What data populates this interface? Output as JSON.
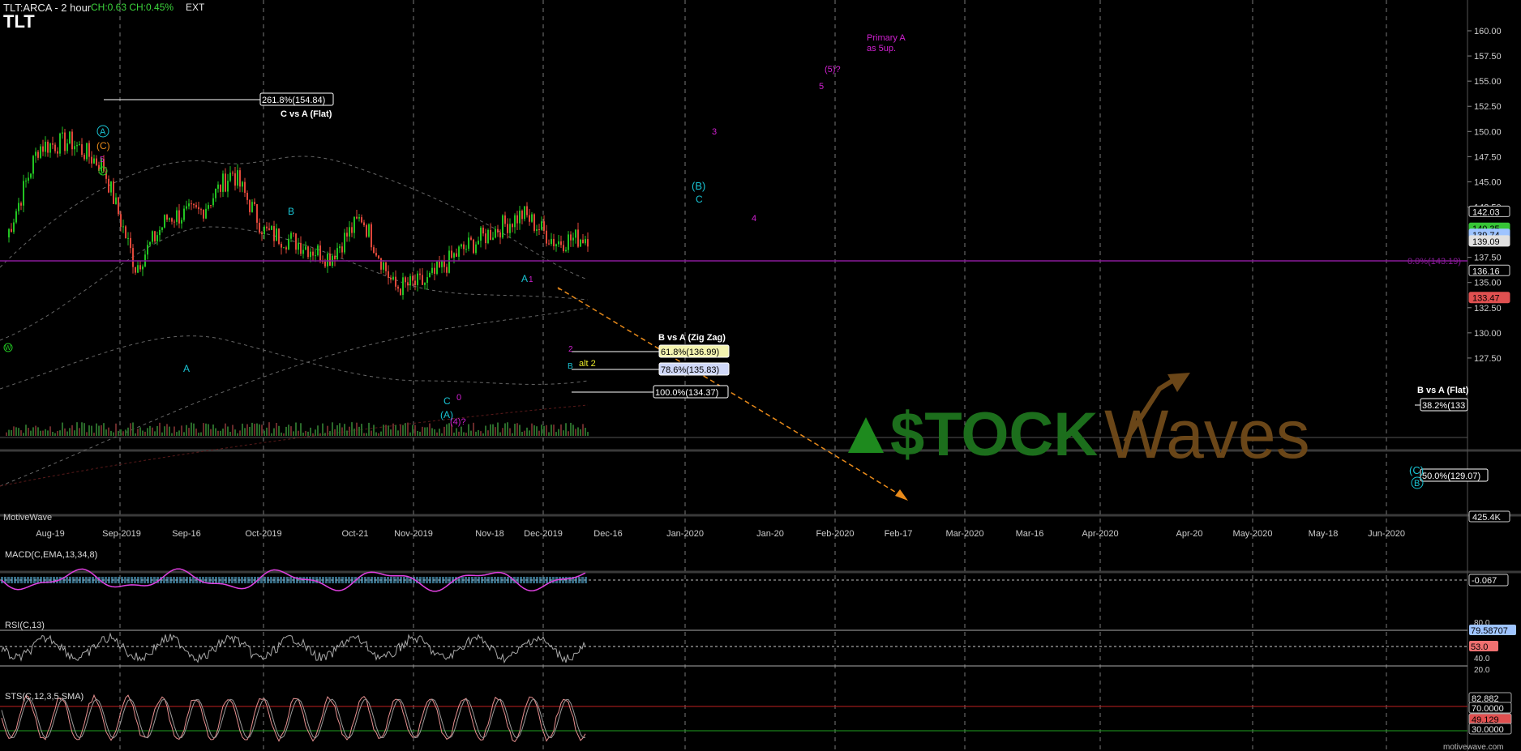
{
  "header": {
    "symbol_line": "TLT:ARCA - 2 hour",
    "change_line": "CH:0.63 CH:0.45%",
    "ext_label": "EXT",
    "ticker": "TLT"
  },
  "price_axis": {
    "ticks": [
      "160.00",
      "157.50",
      "155.00",
      "152.50",
      "150.00",
      "147.50",
      "145.00",
      "142.50",
      "137.50",
      "135.00",
      "132.50",
      "130.00",
      "127.50"
    ],
    "tags": [
      {
        "text": "142.03",
        "color": "#cfcfcf"
      },
      {
        "text": "140.35",
        "color": "#36c436"
      },
      {
        "text": "139.74",
        "color": "#9ec4ff"
      },
      {
        "text": "139.09",
        "color": "#e0e0e0"
      },
      {
        "text": "136.16",
        "color": "#cfcfcf"
      },
      {
        "text": "133.47",
        "color": "#e05050"
      },
      {
        "text": "425.4K",
        "color": "#e0e0e0"
      }
    ]
  },
  "time_axis": [
    "Aug-19",
    "Sep-2019",
    "Sep-16",
    "Oct-2019",
    "Oct-21",
    "Nov-2019",
    "Nov-18",
    "Dec-2019",
    "Dec-16",
    "Jan-2020",
    "Jan-20",
    "Feb-2020",
    "Feb-17",
    "Mar-2020",
    "Mar-16",
    "Apr-2020",
    "Apr-20",
    "May-2020",
    "May-18",
    "Jun-2020"
  ],
  "annotations": {
    "primary_a": [
      "Primary A",
      "as 5up."
    ],
    "fib_2618": "261.8%(154.84)",
    "c_vs_a": "C vs A (Flat)",
    "b_vs_a_zigzag": "B vs A (Zig Zag)",
    "fib_618": "61.8%(136.99)",
    "fib_786": "78.6%(135.83)",
    "fib_100": "100.0%(134.37)",
    "fib_zero": "0.0%(143.19)",
    "b_vs_a_flat": "B vs A (Flat)",
    "fib_382": "38.2%(133",
    "fib_500": "50.0%(129.07)",
    "alt2": "alt 2",
    "source": "MotiveWave",
    "watermark_brand": "$TOCK",
    "watermark_brand2": "Waves",
    "footer": "motivewave.com"
  },
  "wave_labels": {
    "circ_a": "A",
    "c_paren": "(C)",
    "five_top": "5",
    "v_small": "V",
    "b_top": "B",
    "a_low": "A",
    "c_low": "C",
    "a_paren_low": "(A)",
    "zero": "0",
    "four_q": "(4)?",
    "a1": "A",
    "one": "1",
    "two": "2",
    "b_small": "B",
    "b_paren": "(B)",
    "c_proj": "C",
    "three": "3",
    "four": "4",
    "five": "5",
    "five_q": "(5)?",
    "c_right": "(C)",
    "b_right": "B",
    "w_left": "W"
  },
  "indicators": {
    "macd": {
      "label": "MACD(C,EMA,13,34,8)",
      "value": "-0.067"
    },
    "rsi": {
      "label": "RSI(C,13)",
      "ticks": [
        "80.0",
        "40.0",
        "20.0"
      ],
      "value_tag": "79.58707",
      "value_tag2": "53.0"
    },
    "stoch": {
      "label": "STS(C,12,3,5,SMA)",
      "tags": [
        "82.882",
        "70.0000",
        "49.129",
        "30.0000"
      ]
    }
  },
  "colors": {
    "up_candle": "#22c422",
    "down_candle": "#e0483a",
    "wave_cyan": "#19c4d4",
    "wave_magenta": "#d020d0",
    "wave_orange": "#e88a1a",
    "fib_line": "#ffffff",
    "purple_line": "#8a1a9a",
    "macd": "#e040e0",
    "macd_hist": "#5ab0d8"
  },
  "chart_data": {
    "type": "candlestick",
    "title": "TLT:ARCA - 2 hour",
    "x_range": [
      "Aug-2019",
      "Jun-2020"
    ],
    "ylim": [
      126.5,
      161.5
    ],
    "price_path": [
      [
        "Aug-19",
        139.5
      ],
      [
        "Aug-26",
        148.5
      ],
      [
        "Sep-03",
        149.0
      ],
      [
        "Sep-09",
        146.5
      ],
      [
        "Sep-16",
        136.5
      ],
      [
        "Sep-23",
        141.5
      ],
      [
        "Oct-02",
        142.0
      ],
      [
        "Oct-07",
        146.0
      ],
      [
        "Oct-14",
        140.0
      ],
      [
        "Oct-21",
        139.0
      ],
      [
        "Oct-28",
        137.5
      ],
      [
        "Nov-01",
        141.5
      ],
      [
        "Nov-08",
        134.5
      ],
      [
        "Nov-12",
        135.0
      ],
      [
        "Nov-18",
        138.0
      ],
      [
        "Nov-25",
        140.0
      ],
      [
        "Dec-03",
        141.8
      ],
      [
        "Dec-05",
        139.0
      ],
      [
        "Dec-12",
        139.6
      ]
    ],
    "fib_levels": [
      {
        "name": "261.8%",
        "value": 154.84
      },
      {
        "name": "0.0%",
        "value": 143.19
      },
      {
        "name": "61.8%",
        "value": 136.99
      },
      {
        "name": "78.6%",
        "value": 135.83
      },
      {
        "name": "100.0%",
        "value": 134.37
      },
      {
        "name": "38.2%",
        "value": 133
      },
      {
        "name": "50.0%",
        "value": 129.07
      }
    ],
    "last_price": 139.74,
    "volume_last": "425.4K"
  }
}
